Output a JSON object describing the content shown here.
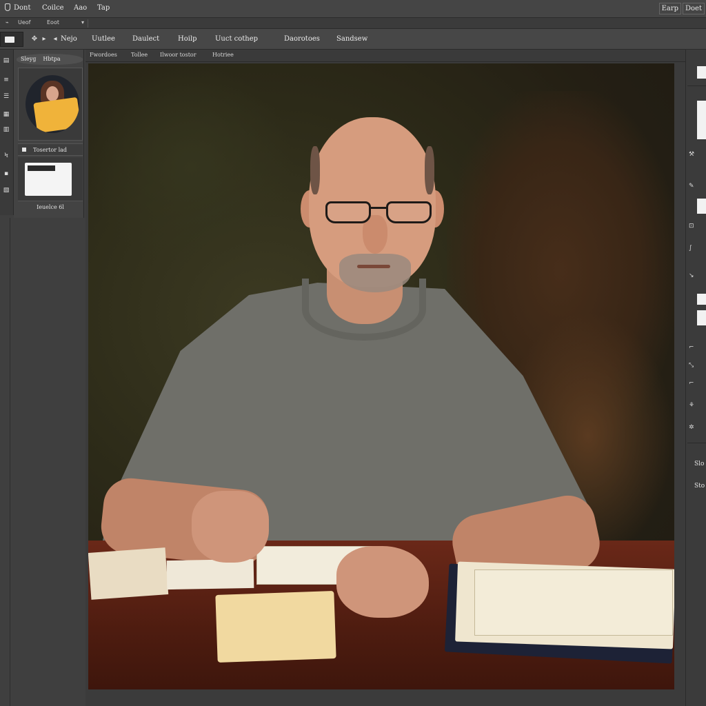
{
  "menu": {
    "items": [
      "Dont",
      "Coilce",
      "Aao",
      "Tap"
    ],
    "right_buttons": [
      "Earp",
      "Doet"
    ]
  },
  "subbar": {
    "left": "Ueof",
    "center": "Eoot"
  },
  "options_bar": {
    "labels": [
      "Nejo",
      "Uutlee",
      "Daulect",
      "Hoilp",
      "Uuct cothep",
      "Daorotoes",
      "Sandsew"
    ]
  },
  "doc_tabs": [
    "Fwordoes",
    "Tollee",
    "Ilwoor tostor",
    "Hotriee"
  ],
  "left_panel": {
    "header_tabs": [
      "Sleyg",
      "Hbtpa"
    ],
    "layer_label": "Tosertor lad",
    "bottom_label": "Ieuelce 6l"
  },
  "right_dock": {
    "labels": [
      "Slo",
      "Sto"
    ]
  },
  "colors": {
    "accent": "#f0b33a",
    "panel": "#434343",
    "menubar": "#454545"
  }
}
